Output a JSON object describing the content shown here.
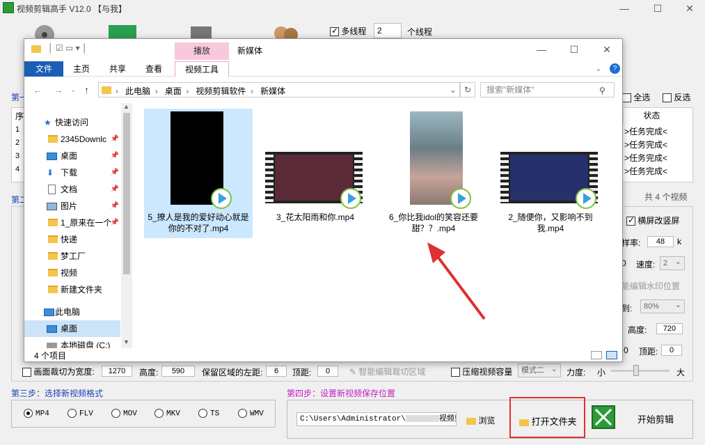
{
  "app": {
    "title": "视频剪辑高手 V12.0   【与我】",
    "multithread_label": "多线程",
    "thread_count": "2",
    "thread_unit": "个线程",
    "select_all": "全选",
    "invert": "反选",
    "status_header": "状态",
    "row_index_header": "序",
    "rows": [
      {
        "idx": "1",
        "status": ">任务完成<"
      },
      {
        "idx": "2",
        "status": ">任务完成<"
      },
      {
        "idx": "3",
        "status": ">任务完成<"
      },
      {
        "idx": "4",
        "status": ">任务完成<"
      }
    ],
    "video_count": "共 4 个视频",
    "landscape_to_portrait": "横屏改竖屏",
    "bitrate_label": "样率:",
    "bitrate_value": "48",
    "bitrate_unit": "k",
    "speed_label": "速度:",
    "speed_value": "2",
    "watermark_label": "能编辑水印位置",
    "to_label": "到:",
    "to_value": "80%",
    "height_label": "高度:",
    "height_value": "720",
    "zero_value": "0",
    "top_label": "顶距:",
    "top_value": "0",
    "crop_width_label": "画面裁切为宽度:",
    "crop_width_value": "1270",
    "crop_height_label": "高度:",
    "crop_height_value": "590",
    "keep_left_label": "保留区域的左距:",
    "keep_left_value": "6",
    "crop_top_label": "顶距:",
    "crop_top_value": "0",
    "smart_crop": "智能编辑裁切区域",
    "compress_label": "压缩视频容量",
    "mode_value": "模式二",
    "strength_label": "力度:",
    "small": "小",
    "large": "大",
    "step1_prefix": "第一",
    "step2_prefix": "第二",
    "step3": "第三步：选择新视频格式",
    "step4": "第四步：设置新视频保存位置",
    "formats": [
      "MP4",
      "FLV",
      "MOV",
      "MKV",
      "TS",
      "WMV"
    ],
    "save_path": "C:\\Users\\Administrator\\",
    "save_path_tail": "视频剪",
    "browse": "浏览",
    "open_folder": "打开文件夹",
    "start": "开始剪辑"
  },
  "explorer": {
    "title": "新媒体",
    "context_tab": "播放",
    "tabs": [
      "文件",
      "主页",
      "共享",
      "查看",
      "视频工具"
    ],
    "breadcrumb": [
      "此电脑",
      "桌面",
      "视频剪辑软件",
      "新媒体"
    ],
    "search_placeholder": "搜索\"新媒体\"",
    "nav": [
      {
        "label": "快速访问",
        "type": "star"
      },
      {
        "label": "2345Downlc",
        "type": "folder",
        "pinned": true
      },
      {
        "label": "桌面",
        "type": "desktop",
        "pinned": true
      },
      {
        "label": "下载",
        "type": "download",
        "pinned": true
      },
      {
        "label": "文档",
        "type": "doc",
        "pinned": true
      },
      {
        "label": "图片",
        "type": "pic",
        "pinned": true
      },
      {
        "label": "1_原来在一个",
        "type": "folder",
        "pinned": true
      },
      {
        "label": "快递",
        "type": "folder"
      },
      {
        "label": "梦工厂",
        "type": "folder"
      },
      {
        "label": "视频",
        "type": "folder"
      },
      {
        "label": "新建文件夹",
        "type": "folder"
      },
      {
        "label": "此电脑",
        "type": "pc"
      },
      {
        "label": "桌面",
        "type": "desktop",
        "selected": true
      },
      {
        "label": "本地磁盘 (C:)",
        "type": "disk"
      }
    ],
    "files": [
      {
        "name": "5_撩人是我的爱好动心就是你的不对了.mp4",
        "selected": true
      },
      {
        "name": "3_花太阳雨和你.mp4"
      },
      {
        "name": "6_你比我idol的笑容还要甜？？.mp4"
      },
      {
        "name": "2_随便你，又影响不到我.mp4"
      }
    ],
    "status": "4 个项目"
  },
  "colors": {
    "accent": "#1b5fb4",
    "highlight": "#e03030",
    "selection": "#cce8ff"
  }
}
